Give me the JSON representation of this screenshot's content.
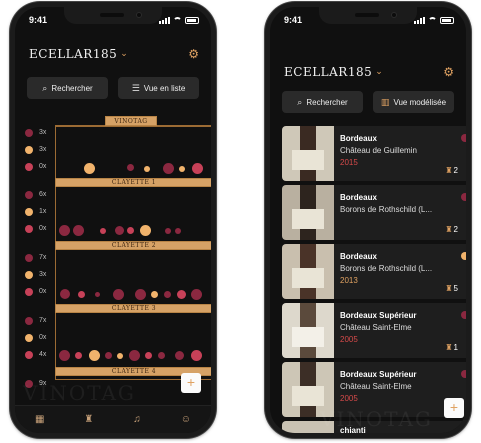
{
  "colors": {
    "red": "#8b2840",
    "rose": "#c74158",
    "gold": "#f1b36c",
    "accent": "#e0a262"
  },
  "left": {
    "time": "9:41",
    "brand": "ECELLAR185",
    "search_label": "Rechercher",
    "view_label": "Vue en liste",
    "cellar_title": "VINOTAG",
    "shelves": [
      "CLAYETTE 1",
      "CLAYETTE 2",
      "CLAYETTE 3",
      "CLAYETTE 4"
    ],
    "side_counts": [
      "3x",
      "3x",
      "0x",
      "6x",
      "1x",
      "0x",
      "7x",
      "3x",
      "0x",
      "7x",
      "0x",
      "4x",
      "9x"
    ],
    "watermark": "VINOTAG",
    "fab": "+"
  },
  "right": {
    "time": "9:41",
    "brand": "ECELLAR185",
    "search_label": "Rechercher",
    "view_label": "Vue modélisée",
    "watermark": "VINOTAG",
    "fab": "+",
    "wines": [
      {
        "region": "Bordeaux",
        "name": "Château de Guillemin",
        "year": "2015",
        "count": "2",
        "yearColor": "red"
      },
      {
        "region": "Bordeaux",
        "name": "Borons de Rothschild (L...",
        "year": "",
        "count": "2",
        "yearColor": "red"
      },
      {
        "region": "Bordeaux",
        "name": "Borons de Rothschild (L...",
        "year": "2013",
        "count": "5",
        "yearColor": "gold"
      },
      {
        "region": "Bordeaux Supérieur",
        "name": "Château Saint-Elme",
        "year": "2005",
        "count": "1",
        "yearColor": "red"
      },
      {
        "region": "Bordeaux Supérieur",
        "name": "Château Saint-Elme",
        "year": "2005",
        "count": "",
        "yearColor": "red"
      },
      {
        "region": "chianti",
        "name": "",
        "year": "",
        "count": "",
        "yearColor": "red"
      }
    ]
  }
}
